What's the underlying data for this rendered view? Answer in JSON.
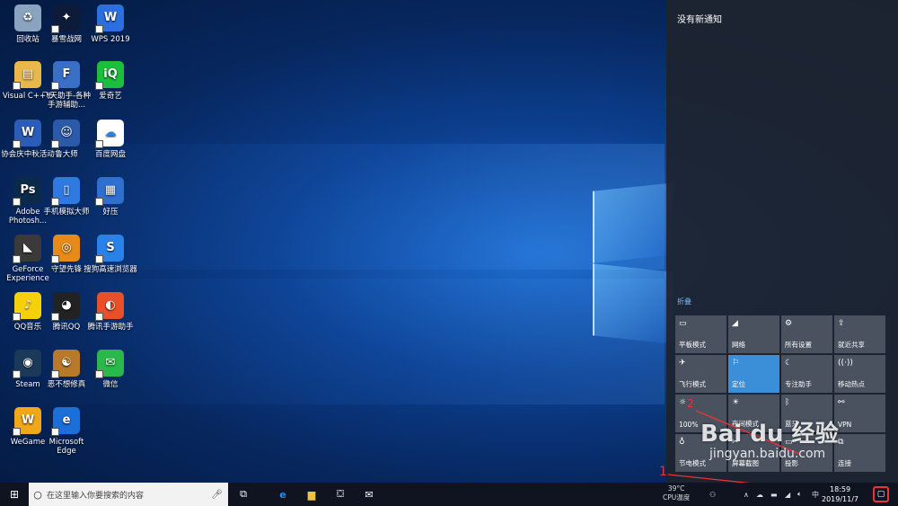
{
  "desktop": {
    "icons": [
      {
        "label": "回收站",
        "icon": "recycle-bin-icon",
        "color": "#8aa4c0",
        "glyph": "♻"
      },
      {
        "label": "暴雪战网",
        "icon": "battlenet-icon",
        "color": "#0e1a3a",
        "glyph": "✦"
      },
      {
        "label": "WPS 2019",
        "icon": "wps-icon",
        "color": "#2b6fe0",
        "glyph": "W"
      },
      {
        "label": "Visual C++ 6",
        "icon": "folder-icon",
        "color": "#e8b84a",
        "glyph": "▤"
      },
      {
        "label": "飞天助手-各种手游辅助...",
        "icon": "feitian-icon",
        "color": "#3a6fc8",
        "glyph": "F"
      },
      {
        "label": "爱奇艺",
        "icon": "iqiyi-icon",
        "color": "#1cbf3c",
        "glyph": "iQ"
      },
      {
        "label": "协会庆中秋活动",
        "icon": "word-doc-icon",
        "color": "#2b5db8",
        "glyph": "W"
      },
      {
        "label": "鲁大师",
        "icon": "ludashi-icon",
        "color": "#2a5aa8",
        "glyph": "☺"
      },
      {
        "label": "百度网盘",
        "icon": "baidu-netdisk-icon",
        "color": "#ffffff",
        "glyph": "☁"
      },
      {
        "label": "Adobe Photosh...",
        "icon": "photoshop-icon",
        "color": "#0b2a4a",
        "glyph": "Ps"
      },
      {
        "label": "手机模拟大师",
        "icon": "phone-emulator-icon",
        "color": "#2e7ae0",
        "glyph": "▯"
      },
      {
        "label": "好压",
        "icon": "haozip-icon",
        "color": "#2e6fd0",
        "glyph": "▦"
      },
      {
        "label": "GeForce Experience",
        "icon": "geforce-icon",
        "color": "#3a3a3a",
        "glyph": "◣"
      },
      {
        "label": "守望先锋",
        "icon": "overwatch-icon",
        "color": "#e88a1a",
        "glyph": "◎"
      },
      {
        "label": "搜狗高速浏览器",
        "icon": "sogou-browser-icon",
        "color": "#2a82e8",
        "glyph": "S"
      },
      {
        "label": "QQ音乐",
        "icon": "qq-music-icon",
        "color": "#f6d10a",
        "glyph": "♪"
      },
      {
        "label": "腾讯QQ",
        "icon": "qq-icon",
        "color": "#222222",
        "glyph": "◕"
      },
      {
        "label": "腾讯手游助手",
        "icon": "tencent-mobile-icon",
        "color": "#e8502a",
        "glyph": "◐"
      },
      {
        "label": "Steam",
        "icon": "steam-icon",
        "color": "#1b3a5a",
        "glyph": "◉"
      },
      {
        "label": "恶不想修真",
        "icon": "xiuzhen-game-icon",
        "color": "#b87a2a",
        "glyph": "☯"
      },
      {
        "label": "微信",
        "icon": "wechat-icon",
        "color": "#2ab84a",
        "glyph": "✉"
      },
      {
        "label": "WeGame",
        "icon": "wegame-icon",
        "color": "#f0a81a",
        "glyph": "W"
      },
      {
        "label": "Microsoft Edge",
        "icon": "edge-icon",
        "color": "#1a6fd8",
        "glyph": "e"
      }
    ]
  },
  "action_center": {
    "title": "没有新通知",
    "collapse_label": "折叠",
    "tiles": [
      {
        "label": "平板模式",
        "icon": "tablet-mode-icon",
        "glyph": "▭",
        "active": false
      },
      {
        "label": "网络",
        "icon": "network-icon",
        "glyph": "◢",
        "active": false
      },
      {
        "label": "所有设置",
        "icon": "gear-icon",
        "glyph": "⚙",
        "active": false
      },
      {
        "label": "就近共享",
        "icon": "nearby-share-icon",
        "glyph": "⇪",
        "active": false
      },
      {
        "label": "飞行模式",
        "icon": "airplane-icon",
        "glyph": "✈",
        "active": false
      },
      {
        "label": "定位",
        "icon": "location-icon",
        "glyph": "⚐",
        "active": true
      },
      {
        "label": "专注助手",
        "icon": "moon-icon",
        "glyph": "☾",
        "active": false
      },
      {
        "label": "移动热点",
        "icon": "hotspot-icon",
        "glyph": "((·))",
        "active": false
      },
      {
        "label": "100%",
        "icon": "brightness-icon",
        "glyph": "☼",
        "active": false
      },
      {
        "label": "夜间模式",
        "icon": "night-light-icon",
        "glyph": "☀",
        "active": false
      },
      {
        "label": "蓝牙",
        "icon": "bluetooth-icon",
        "glyph": "ᛒ",
        "active": false
      },
      {
        "label": "VPN",
        "icon": "vpn-icon",
        "glyph": "⚯",
        "active": false
      },
      {
        "label": "节电模式",
        "icon": "battery-saver-icon",
        "glyph": "♁",
        "active": false
      },
      {
        "label": "屏幕截图",
        "icon": "screenshot-icon",
        "glyph": "✂",
        "active": false
      },
      {
        "label": "投影",
        "icon": "project-icon",
        "glyph": "▭",
        "active": false
      },
      {
        "label": "连接",
        "icon": "connect-icon",
        "glyph": "⧉",
        "active": false
      }
    ]
  },
  "taskbar": {
    "search_placeholder": "在这里输入你要搜索的内容",
    "temp_value": "39°C",
    "temp_label": "CPU温度",
    "ime": "中",
    "time": "18:59",
    "date": "2019/11/7"
  },
  "annotations": {
    "marker_1": "1",
    "marker_2": "2"
  },
  "watermark": {
    "brand": "Bai du 经验",
    "url": "jingyan.baidu.com"
  }
}
